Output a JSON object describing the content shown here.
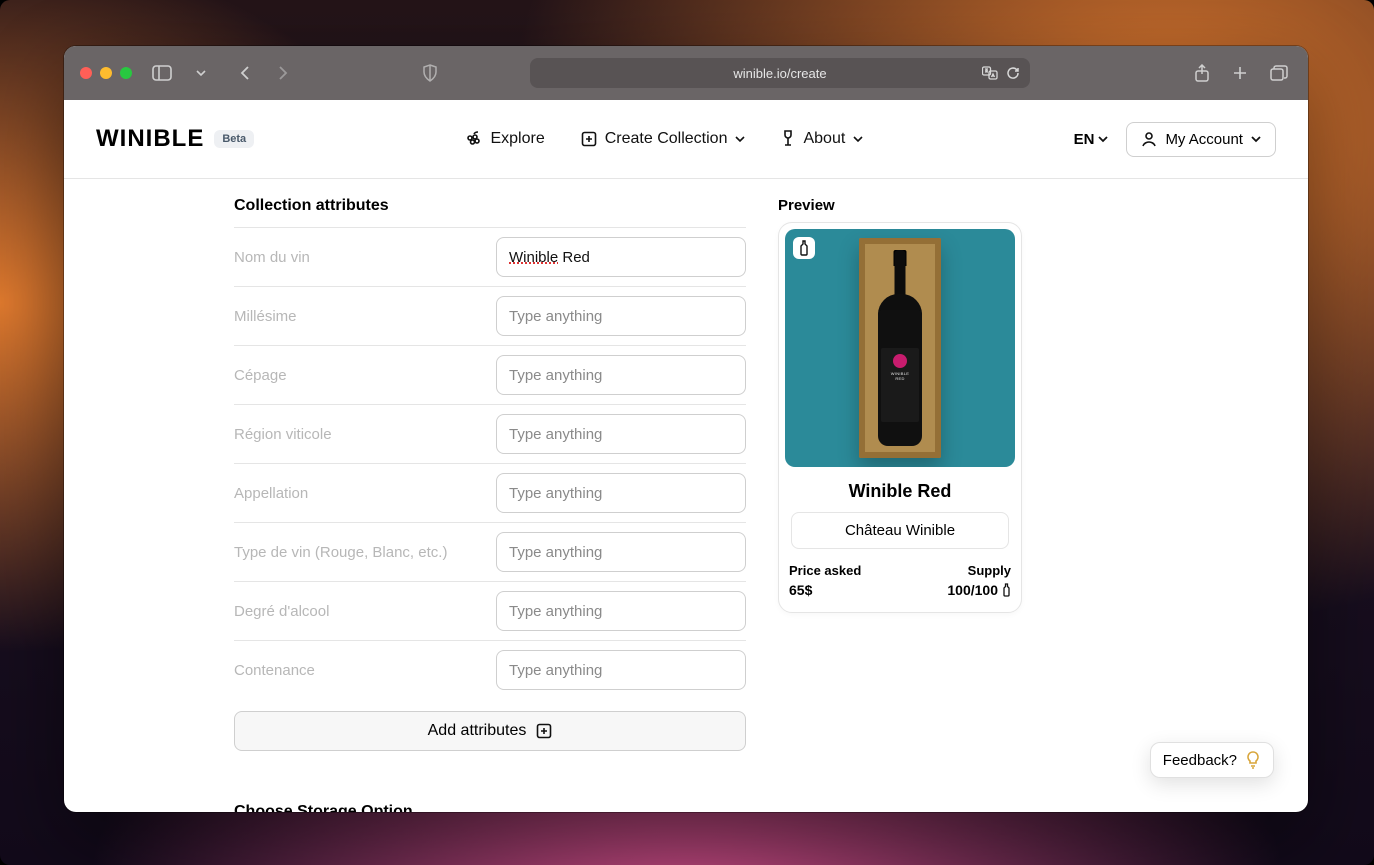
{
  "browser": {
    "url": "winible.io/create"
  },
  "header": {
    "logo": "WINIBLE",
    "badge": "Beta",
    "nav": {
      "explore": "Explore",
      "create": "Create Collection",
      "about": "About"
    },
    "lang": "EN",
    "account": "My Account"
  },
  "form": {
    "heading": "Collection attributes",
    "placeholder": "Type anything",
    "attributes": [
      {
        "label": "Nom du vin",
        "value": "Winible Red",
        "spellword": "Winible"
      },
      {
        "label": "Millésime",
        "value": ""
      },
      {
        "label": "Cépage",
        "value": ""
      },
      {
        "label": "Région viticole",
        "value": ""
      },
      {
        "label": "Appellation",
        "value": ""
      },
      {
        "label": "Type de vin (Rouge, Blanc, etc.)",
        "value": ""
      },
      {
        "label": "Degré d'alcool",
        "value": ""
      },
      {
        "label": "Contenance",
        "value": ""
      }
    ],
    "add_button": "Add attributes",
    "storage_heading": "Choose Storage Option"
  },
  "preview": {
    "label": "Preview",
    "title": "Winible Red",
    "producer": "Château Winible",
    "bottle_label_line1": "WINIBLE",
    "bottle_label_line2": "RED",
    "price_label": "Price asked",
    "price_value": "65$",
    "supply_label": "Supply",
    "supply_value": "100/100"
  },
  "feedback": {
    "label": "Feedback?"
  }
}
